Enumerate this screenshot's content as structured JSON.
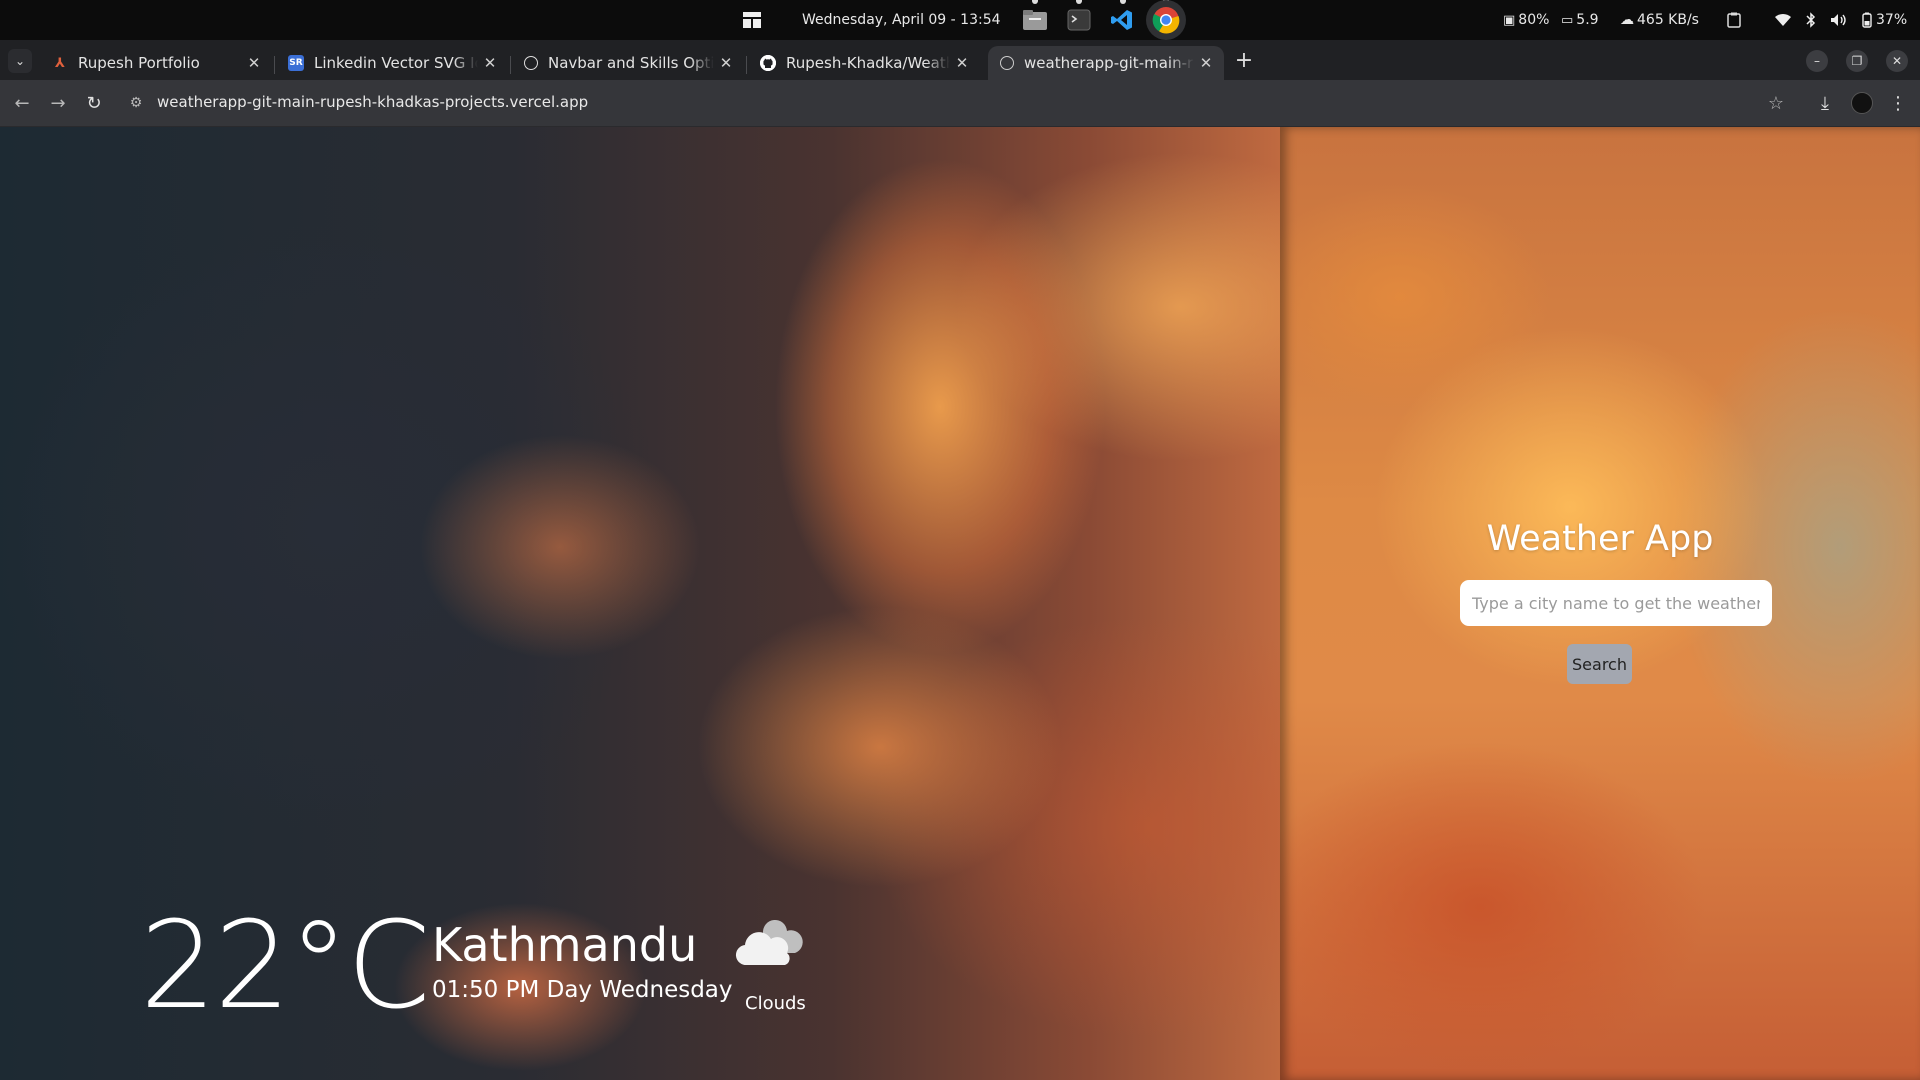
{
  "system_bar": {
    "datetime": "Wednesday, April 09 - 13:54",
    "cpu": "80%",
    "load": "5.9",
    "net": "465 KB/s",
    "battery": "37%",
    "icons": [
      "layout-icon",
      "files-icon",
      "terminal-icon",
      "vscode-icon",
      "chrome-icon",
      "cpu-icon",
      "monitor-icon",
      "cloud-upload-icon",
      "clipboard-icon",
      "wifi-icon",
      "bluetooth-icon",
      "volume-icon",
      "battery-icon"
    ]
  },
  "tabs": [
    {
      "title": "Rupesh Portfolio",
      "favicon": "portfolio-icon",
      "color": "#e0603c"
    },
    {
      "title": "Linkedin Vector SVG Icon",
      "favicon": "svgrepo-icon",
      "color": "#3b6fd6"
    },
    {
      "title": "Navbar and Skills Optimiz",
      "favicon": "openai-icon",
      "color": "#dddddd"
    },
    {
      "title": "Rupesh-Khadka/Weather",
      "favicon": "github-icon",
      "color": "#ffffff"
    },
    {
      "title": "weatherapp-git-main-rup",
      "favicon": "vercel-globe-icon",
      "color": "#cccccc",
      "active": true
    }
  ],
  "toolbar": {
    "url": "weatherapp-git-main-rupesh-khadkas-projects.vercel.app"
  },
  "app": {
    "title": "Weather App",
    "search_placeholder": "Type a city name to get the weather",
    "search_value": "",
    "search_button": "Search"
  },
  "weather": {
    "temperature": "22°C",
    "city": "Kathmandu",
    "datetime": "01:50 PM Day Wednesday",
    "condition": "Clouds",
    "condition_icon": "cloud-icon"
  },
  "colors": {
    "tab_strip": "#202124",
    "toolbar": "#35363a",
    "button": "#a3a7b0"
  }
}
